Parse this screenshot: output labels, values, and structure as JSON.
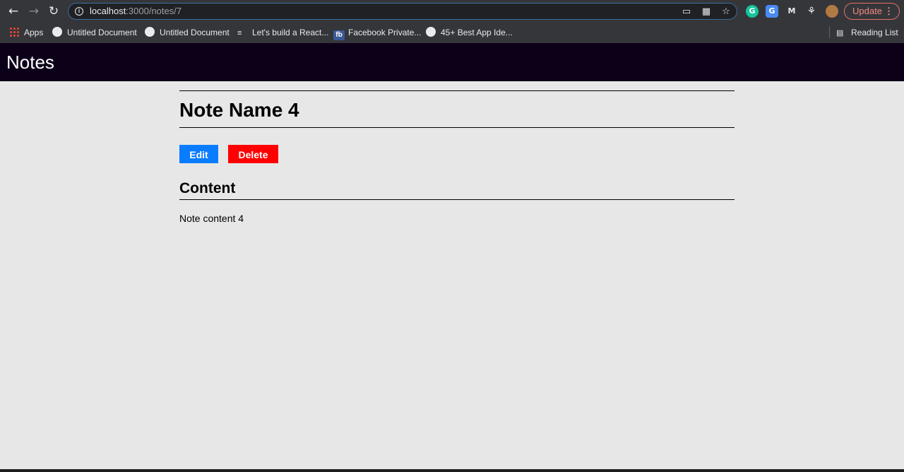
{
  "browser": {
    "url_host": "localhost",
    "url_path": ":3000/notes/7",
    "update_label": "Update",
    "reading_list_label": "Reading List",
    "bookmarks": [
      {
        "label": "Apps",
        "icon": "apps-grid-icon"
      },
      {
        "label": "Untitled Document",
        "icon": "globe-icon"
      },
      {
        "label": "Untitled Document",
        "icon": "globe-icon"
      },
      {
        "label": "Let's build a React...",
        "icon": "list-icon"
      },
      {
        "label": "Facebook Private...",
        "icon": "facebook-icon"
      },
      {
        "label": "45+ Best App Ide...",
        "icon": "globe-icon"
      }
    ]
  },
  "app": {
    "title": "Notes",
    "header_bg": "#0c0019"
  },
  "note": {
    "name": "Note Name 4",
    "edit_label": "Edit",
    "delete_label": "Delete",
    "content_heading": "Content",
    "content": "Note content 4"
  },
  "colors": {
    "edit_button": "#0a7cff",
    "delete_button": "#ff0000",
    "page_background": "#e7e7e7"
  }
}
